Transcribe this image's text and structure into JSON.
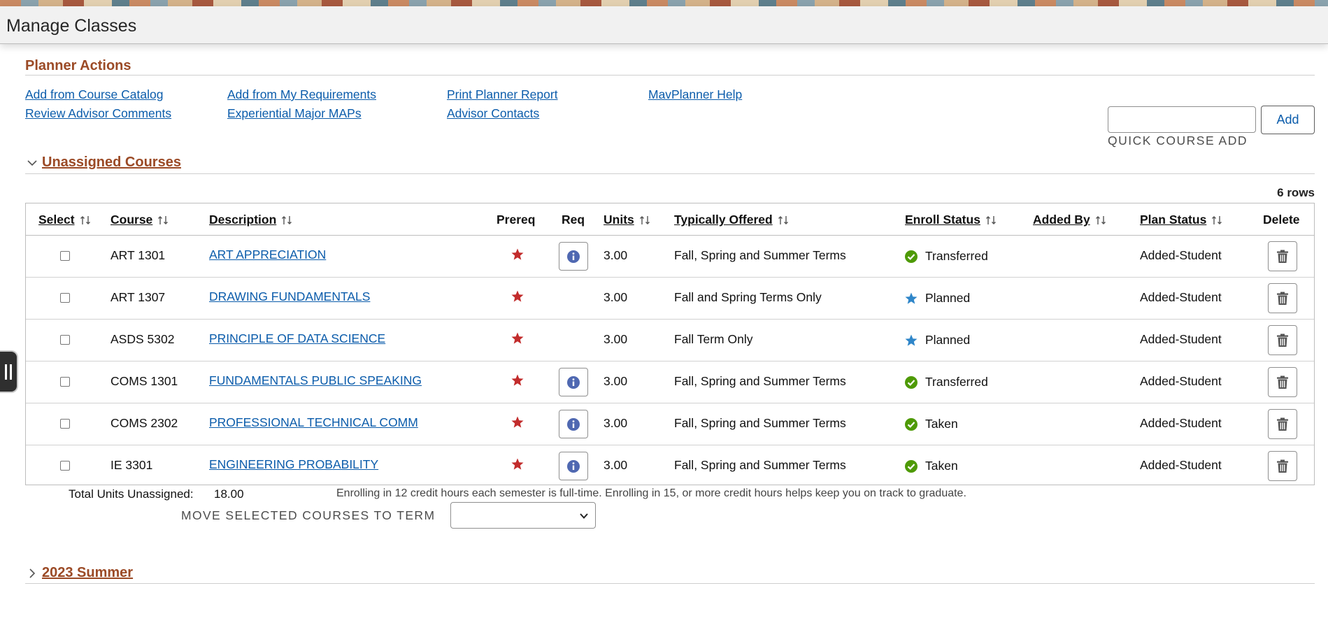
{
  "page": {
    "title": "Manage Classes"
  },
  "planner_actions": {
    "title": "Planner Actions",
    "links": [
      "Add from Course Catalog",
      "Add from My Requirements",
      "Print Planner Report",
      "MavPlanner Help",
      "Review Advisor Comments",
      "Experiential Major MAPs",
      "Advisor Contacts"
    ]
  },
  "quick_add": {
    "label": "QUICK COURSE ADD",
    "button": "Add",
    "value": ""
  },
  "unassigned": {
    "title": "Unassigned Courses",
    "row_count": "6 rows",
    "headers": {
      "select": "Select",
      "course": "Course",
      "description": "Description",
      "prereq": "Prereq",
      "req": "Req",
      "units": "Units",
      "offered": "Typically Offered",
      "enroll": "Enroll Status",
      "added_by": "Added By",
      "plan_status": "Plan Status",
      "delete": "Delete"
    },
    "rows": [
      {
        "course": "ART 1301",
        "description": "ART APPRECIATION",
        "units": "3.00",
        "offered": "Fall, Spring and Summer Terms",
        "enroll_status": "Transferred",
        "status_icon": "check-circle",
        "added_by": "",
        "plan_status": "Added-Student",
        "req_info": true
      },
      {
        "course": "ART 1307",
        "description": "DRAWING FUNDAMENTALS",
        "units": "3.00",
        "offered": "Fall and Spring Terms Only",
        "enroll_status": "Planned",
        "status_icon": "star",
        "added_by": "",
        "plan_status": "Added-Student",
        "req_info": false
      },
      {
        "course": "ASDS 5302",
        "description": "PRINCIPLE OF DATA SCIENCE",
        "units": "3.00",
        "offered": "Fall Term Only",
        "enroll_status": "Planned",
        "status_icon": "star",
        "added_by": "",
        "plan_status": "Added-Student",
        "req_info": false
      },
      {
        "course": "COMS 1301",
        "description": "FUNDAMENTALS PUBLIC SPEAKING",
        "units": "3.00",
        "offered": "Fall, Spring and Summer Terms",
        "enroll_status": "Transferred",
        "status_icon": "check-circle",
        "added_by": "",
        "plan_status": "Added-Student",
        "req_info": true
      },
      {
        "course": "COMS 2302",
        "description": "PROFESSIONAL TECHNICAL COMM",
        "units": "3.00",
        "offered": "Fall, Spring and Summer Terms",
        "enroll_status": "Taken",
        "status_icon": "check-circle",
        "added_by": "",
        "plan_status": "Added-Student",
        "req_info": true
      },
      {
        "course": "IE 3301",
        "description": "ENGINEERING PROBABILITY",
        "units": "3.00",
        "offered": "Fall, Spring and Summer Terms",
        "enroll_status": "Taken",
        "status_icon": "check-circle",
        "added_by": "",
        "plan_status": "Added-Student",
        "req_info": true
      }
    ],
    "total_label": "Total Units Unassigned:",
    "total_value": "18.00",
    "advice": "Enrolling in 12 credit hours each semester is full-time. Enrolling in 15, or more credit hours helps keep you on track to graduate.",
    "move_label": "MOVE SELECTED COURSES TO TERM",
    "move_selected": ""
  },
  "term": {
    "title": "2023 Summer"
  },
  "colors": {
    "accent": "#9b4a26",
    "link": "#0b5cab",
    "check": "#4e9a06",
    "star": "#2f86c9",
    "prereq_star": "#c22c2c"
  }
}
